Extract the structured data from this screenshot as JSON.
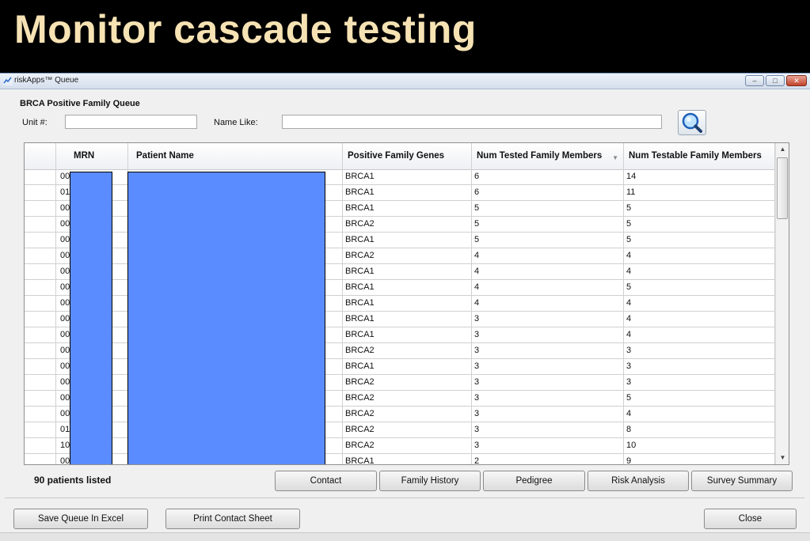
{
  "slide": {
    "title": "Monitor cascade testing"
  },
  "window": {
    "title": "riskApps™ Queue",
    "minimize": "–",
    "maximize": "□",
    "close": "✕"
  },
  "group": {
    "label": "BRCA Positive Family Queue"
  },
  "filters": {
    "unit_label": "Unit #:",
    "unit_value": "",
    "name_label": "Name Like:",
    "name_value": ""
  },
  "table": {
    "columns": [
      "MRN",
      "Patient Name",
      "Positive Family Genes",
      "Num Tested Family Members",
      "Num Testable Family Members"
    ],
    "rows": [
      {
        "mrn": "00",
        "gene": "BRCA1",
        "tested": "6",
        "testable": "14"
      },
      {
        "mrn": "01",
        "gene": "BRCA1",
        "tested": "6",
        "testable": "11"
      },
      {
        "mrn": "00",
        "gene": "BRCA1",
        "tested": "5",
        "testable": "5"
      },
      {
        "mrn": "00",
        "gene": "BRCA2",
        "tested": "5",
        "testable": "5"
      },
      {
        "mrn": "00",
        "gene": "BRCA1",
        "tested": "5",
        "testable": "5"
      },
      {
        "mrn": "00",
        "gene": "BRCA2",
        "tested": "4",
        "testable": "4"
      },
      {
        "mrn": "00",
        "gene": "BRCA1",
        "tested": "4",
        "testable": "4"
      },
      {
        "mrn": "00",
        "gene": "BRCA1",
        "tested": "4",
        "testable": "5"
      },
      {
        "mrn": "00",
        "gene": "BRCA1",
        "tested": "4",
        "testable": "4"
      },
      {
        "mrn": "00",
        "gene": "BRCA1",
        "tested": "3",
        "testable": "4"
      },
      {
        "mrn": "00",
        "gene": "BRCA1",
        "tested": "3",
        "testable": "4"
      },
      {
        "mrn": "00",
        "gene": "BRCA2",
        "tested": "3",
        "testable": "3"
      },
      {
        "mrn": "00",
        "gene": "BRCA1",
        "tested": "3",
        "testable": "3"
      },
      {
        "mrn": "00",
        "gene": "BRCA2",
        "tested": "3",
        "testable": "3"
      },
      {
        "mrn": "00",
        "gene": "BRCA2",
        "tested": "3",
        "testable": "5"
      },
      {
        "mrn": "00",
        "gene": "BRCA2",
        "tested": "3",
        "testable": "4"
      },
      {
        "mrn": "01",
        "gene": "BRCA2",
        "tested": "3",
        "testable": "8"
      },
      {
        "mrn": "10",
        "gene": "BRCA2",
        "tested": "3",
        "testable": "10"
      },
      {
        "mrn": "00",
        "gene": "BRCA1",
        "tested": "2",
        "testable": "9"
      }
    ]
  },
  "footer": {
    "count": "90 patients listed",
    "buttons": [
      "Contact",
      "Family History",
      "Pedigree",
      "Risk Analysis",
      "Survey Summary"
    ],
    "save": "Save Queue In Excel",
    "print": "Print Contact Sheet",
    "close": "Close"
  },
  "colors": {
    "title": "#f6e2b3",
    "redaction": "#5b8cff"
  }
}
